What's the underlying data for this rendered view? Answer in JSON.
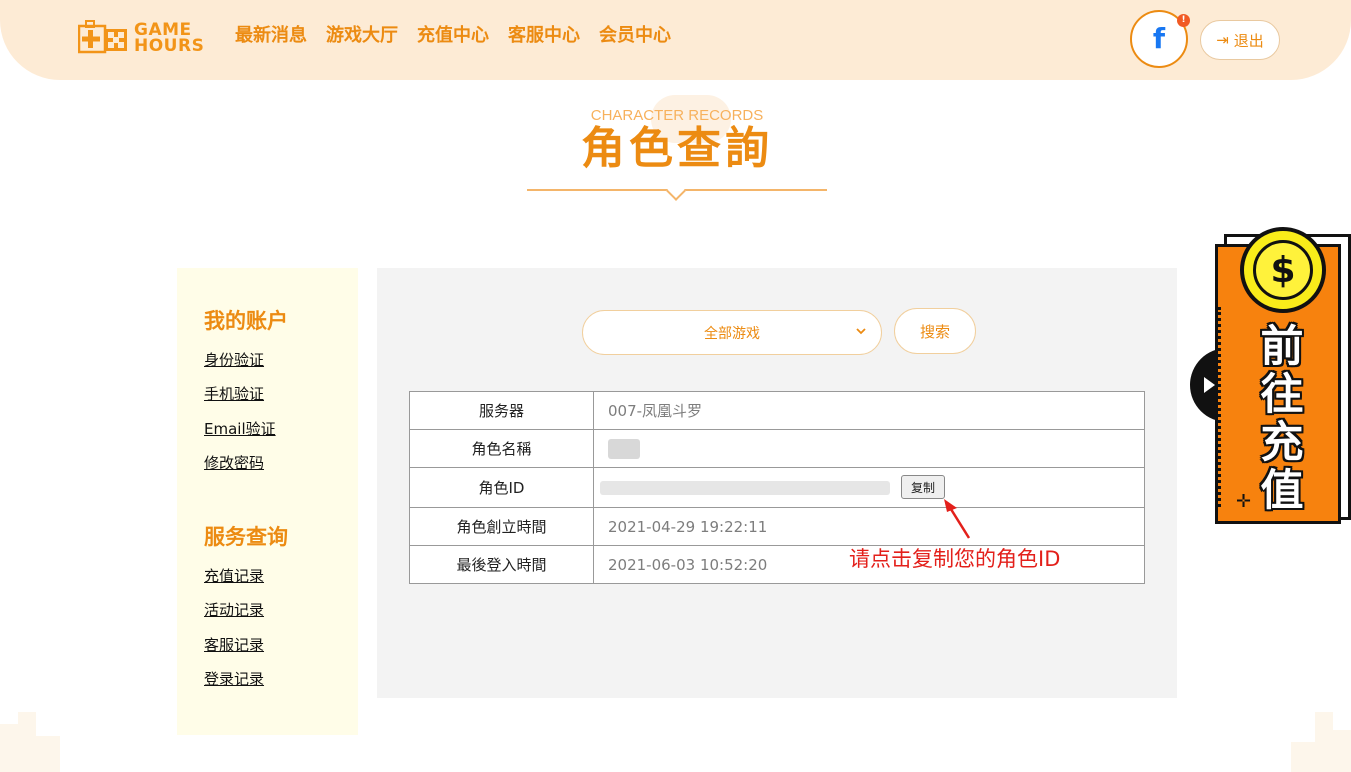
{
  "header": {
    "logo_line1": "GAME",
    "logo_line2": "HOURS",
    "nav": [
      "最新消息",
      "游戏大厅",
      "充值中心",
      "客服中心",
      "会员中心"
    ],
    "facebook_icon": "f",
    "facebook_badge": "!",
    "logout_icon": "⇥",
    "logout_label": "退出"
  },
  "title": {
    "en": "CHARACTER RECORDS",
    "zh": "角色查詢"
  },
  "sidebar": {
    "account_heading": "我的账户",
    "account_links": [
      "身份验证",
      "手机验证",
      "Email验证",
      "修改密码"
    ],
    "service_heading": "服务查询",
    "service_links": [
      "充值记录",
      "活动记录",
      "客服记录",
      "登录记录"
    ]
  },
  "filter": {
    "game_select_value": "全部游戏",
    "search_label": "搜索"
  },
  "record": {
    "server_label": "服务器",
    "server_value": "007-凤凰斗罗",
    "name_label": "角色名稱",
    "id_label": "角色ID",
    "copy_label": "复制",
    "created_label": "角色創立時間",
    "created_value": "2021-04-29 19:22:11",
    "last_login_label": "最後登入時間",
    "last_login_value": "2021-06-03 10:52:20"
  },
  "annotation": {
    "note": "请点击复制您的角色ID"
  },
  "floating_widget": {
    "coin_symbol": "$",
    "label_chars": [
      "前",
      "往",
      "充",
      "值"
    ]
  },
  "colors": {
    "accent": "#ec8b12",
    "header_bg": "#fdebd5",
    "sidebar_bg": "#fffde8",
    "panel_bg": "#f3f3f3",
    "note_red": "#e3201b",
    "widget_orange": "#f7820e",
    "coin_yellow": "#f9ec1a"
  }
}
